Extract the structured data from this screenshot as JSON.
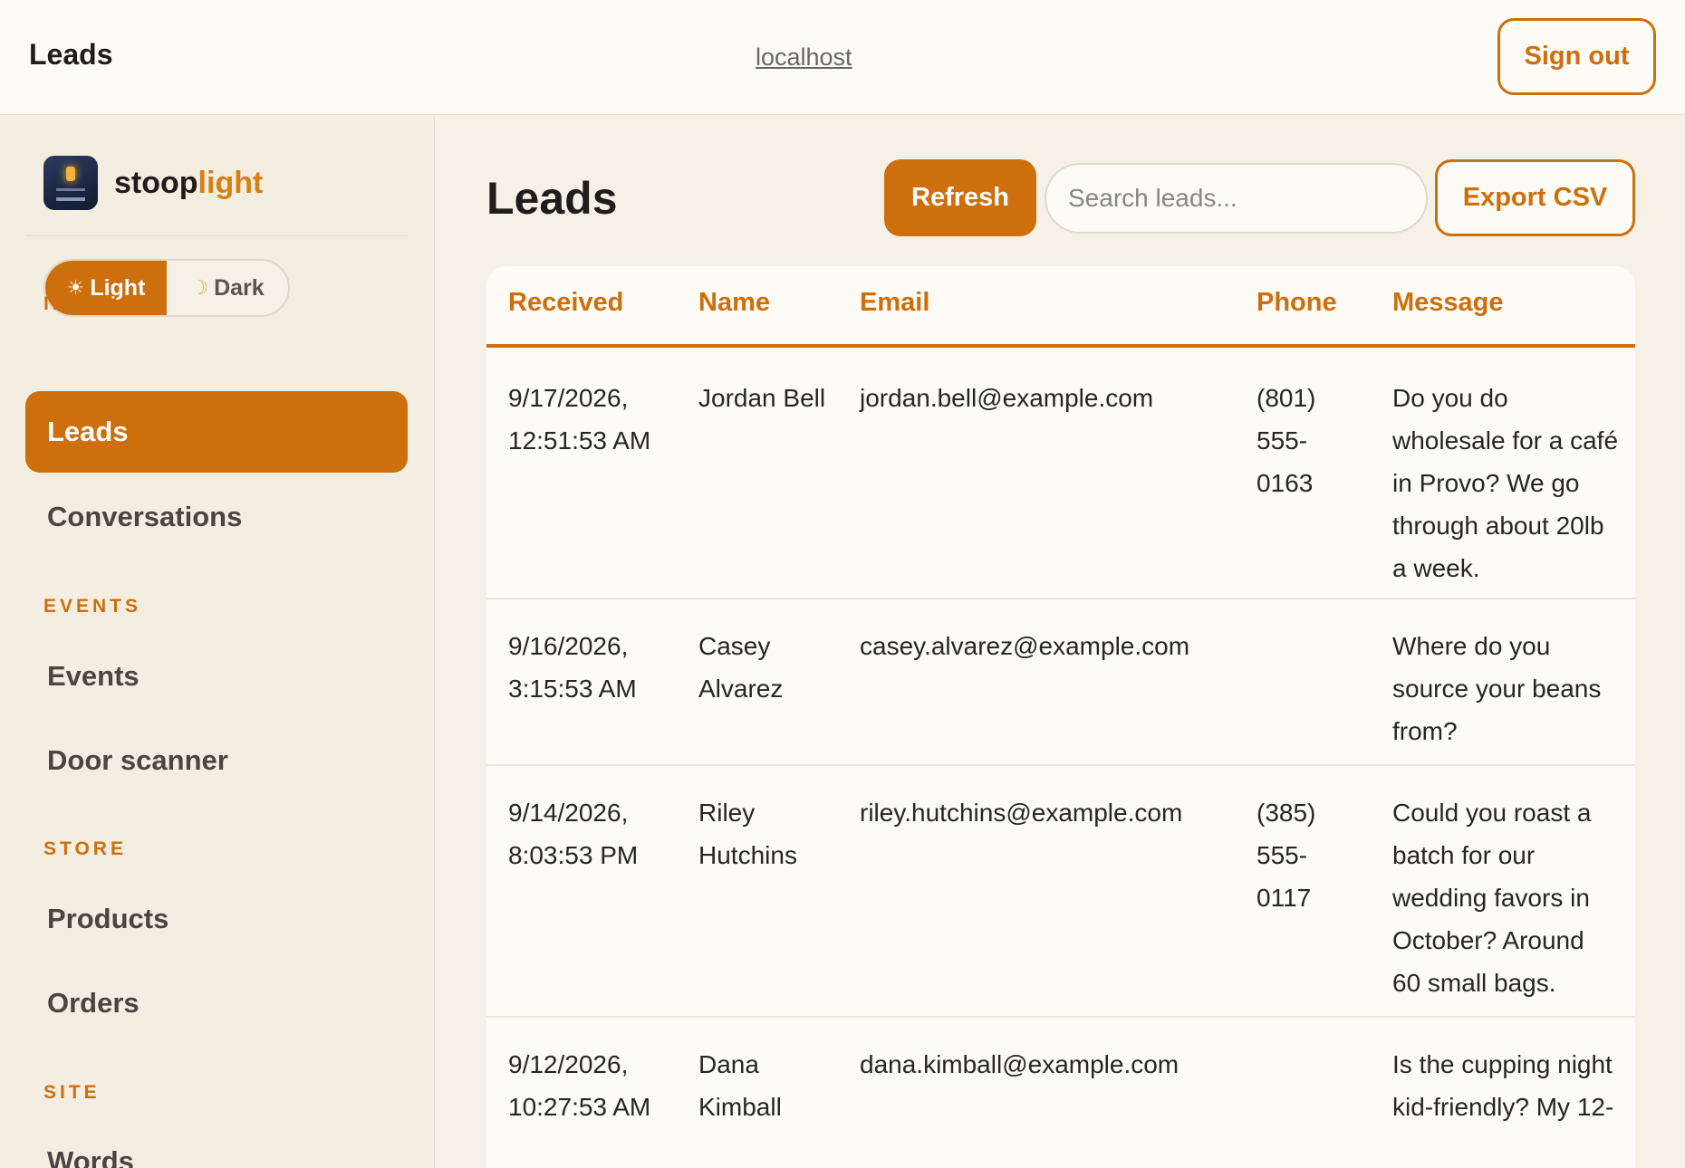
{
  "header": {
    "title": "Leads",
    "host": "localhost",
    "signout_label": "Sign out"
  },
  "sidebar": {
    "brand": {
      "name_part1": "stoop",
      "name_part2": "light"
    },
    "theme": {
      "light_label": "Light",
      "dark_label": "Dark",
      "active": "light"
    },
    "sections": [
      {
        "label": "INBOX",
        "items": [
          {
            "label": "Leads",
            "active": true
          },
          {
            "label": "Conversations"
          }
        ]
      },
      {
        "label": "EVENTS",
        "items": [
          {
            "label": "Events"
          },
          {
            "label": "Door scanner"
          }
        ]
      },
      {
        "label": "STORE",
        "items": [
          {
            "label": "Products"
          },
          {
            "label": "Orders"
          }
        ]
      },
      {
        "label": "SITE",
        "items": [
          {
            "label": "Words"
          }
        ]
      }
    ]
  },
  "main": {
    "title": "Leads",
    "refresh_label": "Refresh",
    "search_placeholder": "Search leads...",
    "export_label": "Export CSV",
    "table": {
      "columns": [
        "Received",
        "Name",
        "Email",
        "Phone",
        "Message"
      ],
      "rows": [
        {
          "received": "9/17/2026, 12:51:53 AM",
          "name": "Jordan Bell",
          "email": "jordan.bell@example.com",
          "phone": "(801) 555-0163",
          "message": "Do you do wholesale for a café in Provo? We go through about 20lb a week."
        },
        {
          "received": "9/16/2026, 3:15:53 AM",
          "name": "Casey Alvarez",
          "email": "casey.alvarez@example.com",
          "phone": "",
          "message": "Where do you source your beans from?"
        },
        {
          "received": "9/14/2026, 8:03:53 PM",
          "name": "Riley Hutchins",
          "email": "riley.hutchins@example.com",
          "phone": "(385) 555-0117",
          "message": "Could you roast a batch for our wedding favors in October? Around 60 small bags."
        },
        {
          "received": "9/12/2026, 10:27:53 AM",
          "name": "Dana Kimball",
          "email": "dana.kimball@example.com",
          "phone": "",
          "message": "Is the cupping night kid-friendly? My 12-"
        }
      ]
    }
  },
  "colors": {
    "accent": "#cc6f0c",
    "background": "#f6f1e7",
    "surface": "#fcfbf6"
  }
}
